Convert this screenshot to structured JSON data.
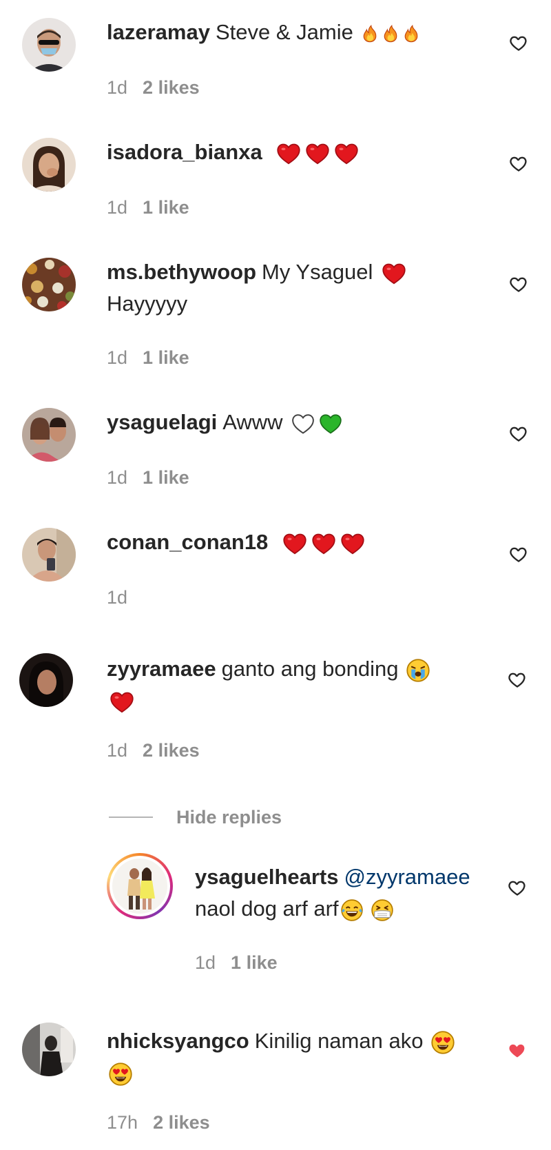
{
  "comments": [
    {
      "username": "lazeramay",
      "text": "Steve & Jamie",
      "time": "1d",
      "likes": "2 likes"
    },
    {
      "username": "isadora_bianxa",
      "text": "",
      "time": "1d",
      "likes": "1 like"
    },
    {
      "username": "ms.bethywoop",
      "text": "My Ysaguel",
      "text2": "Hayyyyy",
      "time": "1d",
      "likes": "1 like"
    },
    {
      "username": "ysaguelagi",
      "text": "Awww",
      "time": "1d",
      "likes": "1 like"
    },
    {
      "username": "conan_conan18",
      "text": "",
      "time": "1d",
      "likes": ""
    },
    {
      "username": "zyyramaee",
      "text": "ganto ang bonding",
      "time": "1d",
      "likes": "2 likes"
    },
    {
      "username": "nhicksyangco",
      "text": "Kinilig naman ako",
      "time": "17h",
      "likes": "2 likes"
    }
  ],
  "hide_replies": "Hide replies",
  "reply": {
    "username": "ysaguelhearts",
    "mention": "@zyyramaee",
    "text": "naol dog arf arf",
    "time": "1d",
    "likes": "1 like"
  },
  "colors": {
    "liked_heart": "#ed4956",
    "link": "#00376b",
    "meta": "#8e8e8e"
  },
  "icons": [
    "heart-outline-icon",
    "heart-filled-icon",
    "fire-emoji",
    "red-heart-emoji",
    "white-heart-emoji",
    "green-heart-emoji",
    "crying-emoji",
    "laughing-tears-emoji",
    "sick-emoji",
    "heart-eyes-emoji"
  ]
}
